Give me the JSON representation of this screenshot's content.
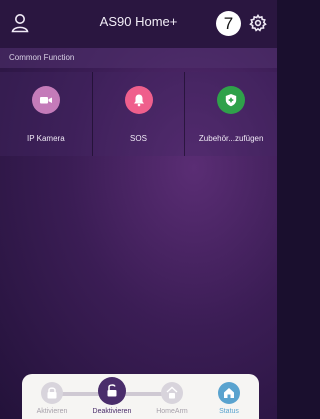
{
  "header": {
    "title": "AS90 Home+",
    "badge": "7"
  },
  "section": {
    "label": "Common Function"
  },
  "functions": [
    {
      "label": "IP Kamera",
      "color": "#c47bb9",
      "icon": "video-camera-icon"
    },
    {
      "label": "SOS",
      "color": "#ef5f8c",
      "icon": "bell-icon"
    },
    {
      "label": "Zubehör...zufügen",
      "color": "#2fa14a",
      "icon": "shield-plus-icon"
    }
  ],
  "modes": [
    {
      "label": "Aktivieren",
      "icon": "lock-icon",
      "active": false
    },
    {
      "label": "Deaktivieren",
      "icon": "unlock-icon",
      "active": true
    },
    {
      "label": "HomeArm",
      "icon": "home-lock-icon",
      "active": false
    },
    {
      "label": "Status",
      "icon": "home-icon",
      "active": false
    }
  ],
  "colors": {
    "header_bg": "#2a1640",
    "active_mode": "#4a2d6b",
    "status_blue": "#5aa3cf"
  }
}
